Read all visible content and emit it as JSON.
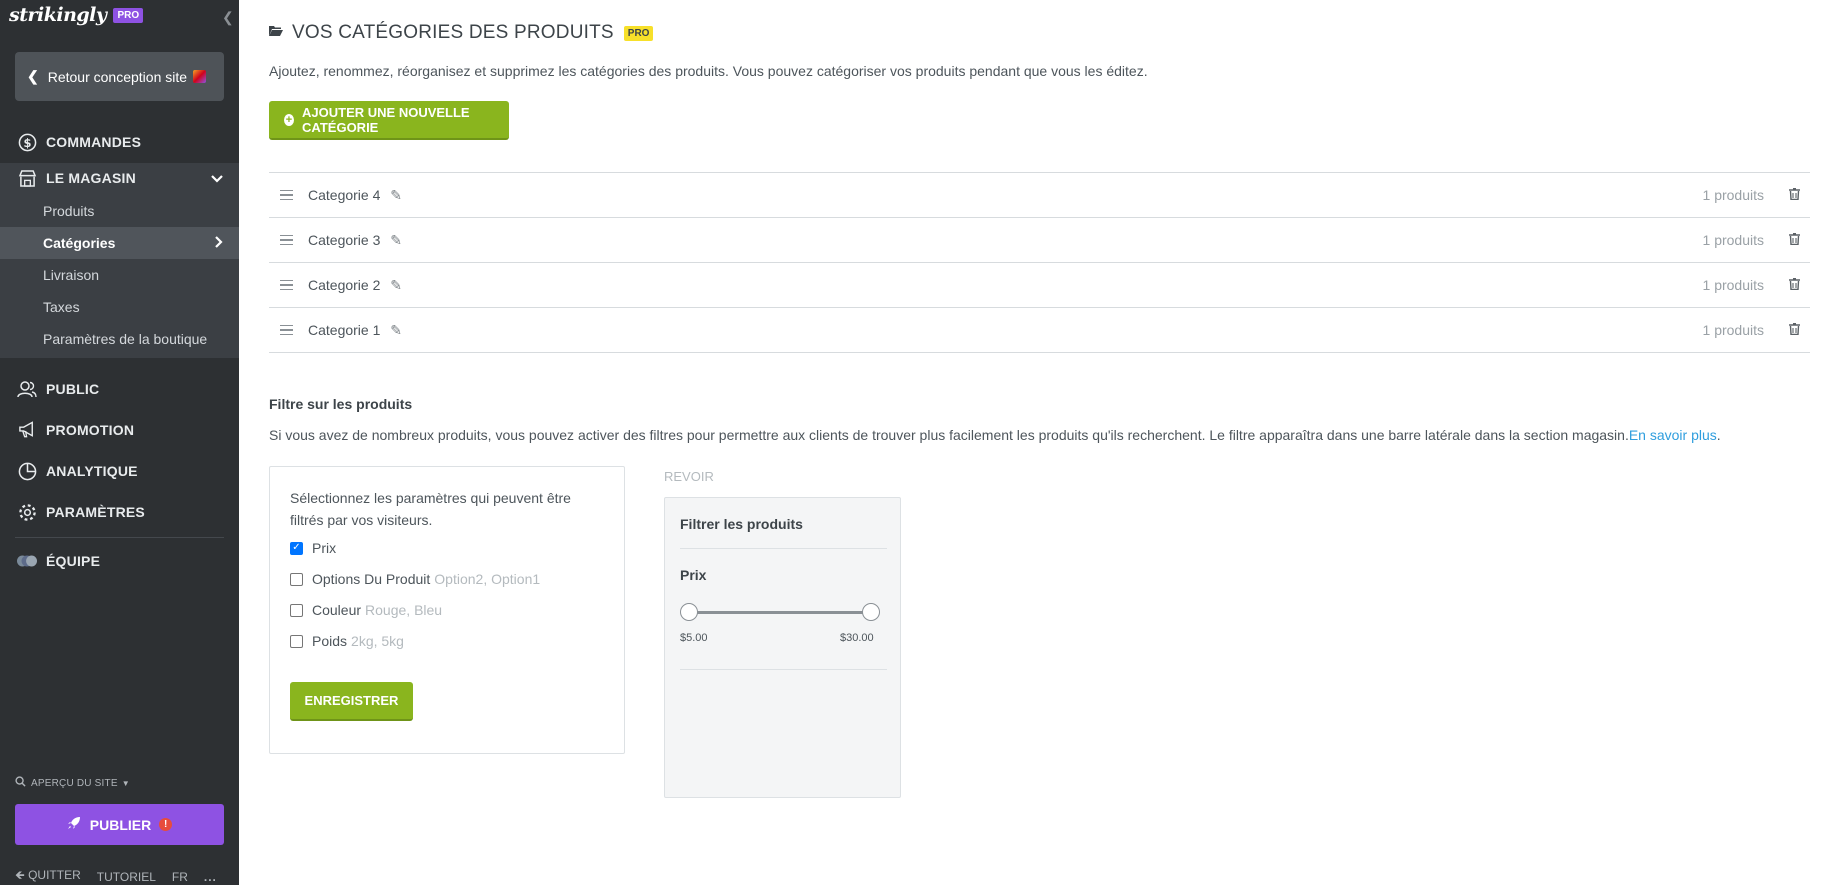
{
  "sidebar": {
    "logo": "strikingly",
    "pro_badge": "PRO",
    "back_label": "Retour conception site",
    "nav": {
      "orders": "COMMANDES",
      "store": "LE MAGASIN",
      "public": "PUBLIC",
      "promotion": "PROMOTION",
      "analytics": "ANALYTIQUE",
      "settings": "PARAMÈTRES",
      "team": "ÉQUIPE"
    },
    "store_sub": {
      "products": "Produits",
      "categories": "Catégories",
      "shipping": "Livraison",
      "taxes": "Taxes",
      "shop_settings": "Paramètres de la boutique"
    },
    "site_preview": "APERÇU DU SITE",
    "publish": "PUBLIER",
    "publish_alert": "!",
    "quit": "QUITTER",
    "tutorial": "TUTORIEL",
    "lang": "FR",
    "more": "..."
  },
  "main": {
    "title": "VOS CATÉGORIES DES PRODUITS",
    "pro_badge": "PRO",
    "description": "Ajoutez, renommez, réorganisez et supprimez les catégories des produits. Vous pouvez catégoriser vos produits pendant que vous les éditez.",
    "add_button": "AJOUTER UNE NOUVELLE CATÉGORIE",
    "categories": [
      {
        "name": "Categorie 4",
        "count": "1 produits"
      },
      {
        "name": "Categorie 3",
        "count": "1 produits"
      },
      {
        "name": "Categorie 2",
        "count": "1 produits"
      },
      {
        "name": "Categorie 1",
        "count": "1 produits"
      }
    ],
    "filter": {
      "title": "Filtre sur les produits",
      "description": "Si vous avez de nombreux produits, vous pouvez activer des filtres pour permettre aux clients de trouver plus facilement les produits qu'ils recherchent. Le filtre apparaîtra dans une barre latérale dans la section magasin.",
      "learn_more": "En savoir plus",
      "intro": "Sélectionnez les paramètres qui peuvent être filtrés par vos visiteurs.",
      "options": [
        {
          "label": "Prix",
          "hint": "",
          "checked": true
        },
        {
          "label": "Options Du Produit",
          "hint": "Option2, Option1",
          "checked": false
        },
        {
          "label": "Couleur",
          "hint": "Rouge, Bleu",
          "checked": false
        },
        {
          "label": "Poids",
          "hint": "2kg, 5kg",
          "checked": false
        }
      ],
      "save_button": "ENREGISTRER"
    },
    "preview": {
      "label": "REVOIR",
      "title": "Filtrer les produits",
      "price_label": "Prix",
      "min": "$5.00",
      "max": "$30.00"
    }
  },
  "colors": {
    "sidebar_bg": "#2d3033",
    "accent_green": "#8ab51e",
    "publish_purple": "#8e52e3",
    "pro_yellow": "#f7e02a",
    "link_blue": "#2f9ede"
  }
}
